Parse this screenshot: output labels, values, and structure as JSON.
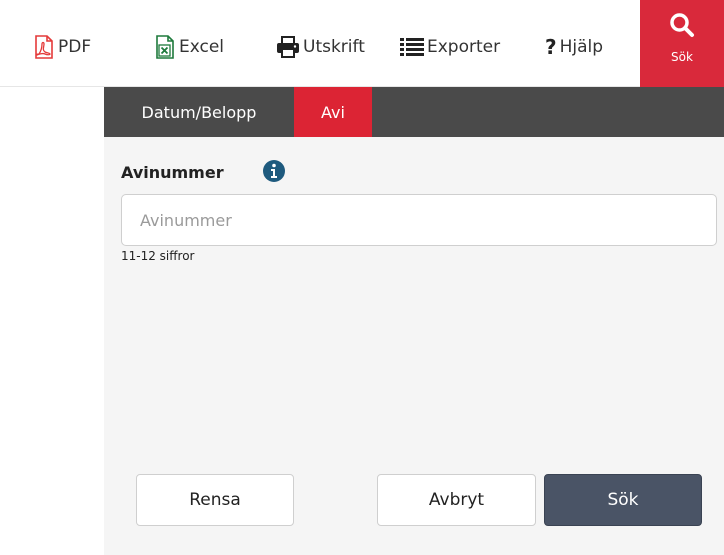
{
  "toolbar": {
    "pdf_label": "PDF",
    "excel_label": "Excel",
    "print_label": "Utskrift",
    "export_label": "Exporter",
    "help_label": "Hjälp",
    "search_label": "Sök"
  },
  "tabs": [
    {
      "label": "Datum/Belopp",
      "active": false
    },
    {
      "label": "Avi",
      "active": true
    }
  ],
  "form": {
    "field_label": "Avinummer",
    "field_value": "",
    "field_placeholder": "Avinummer",
    "field_hint": "11-12 siffror"
  },
  "actions": {
    "clear_label": "Rensa",
    "cancel_label": "Avbryt",
    "submit_label": "Sök"
  },
  "colors": {
    "accent_red": "#dc2434",
    "tabbar_bg": "#4a4a4a",
    "submit_bg": "#4a5466",
    "info_blue": "#1e5a7e",
    "pdf_red": "#e43a3a",
    "excel_green": "#1e7a3c"
  },
  "icons": [
    "pdf-icon",
    "excel-icon",
    "printer-icon",
    "list-icon",
    "question-icon",
    "search-icon",
    "info-icon"
  ]
}
